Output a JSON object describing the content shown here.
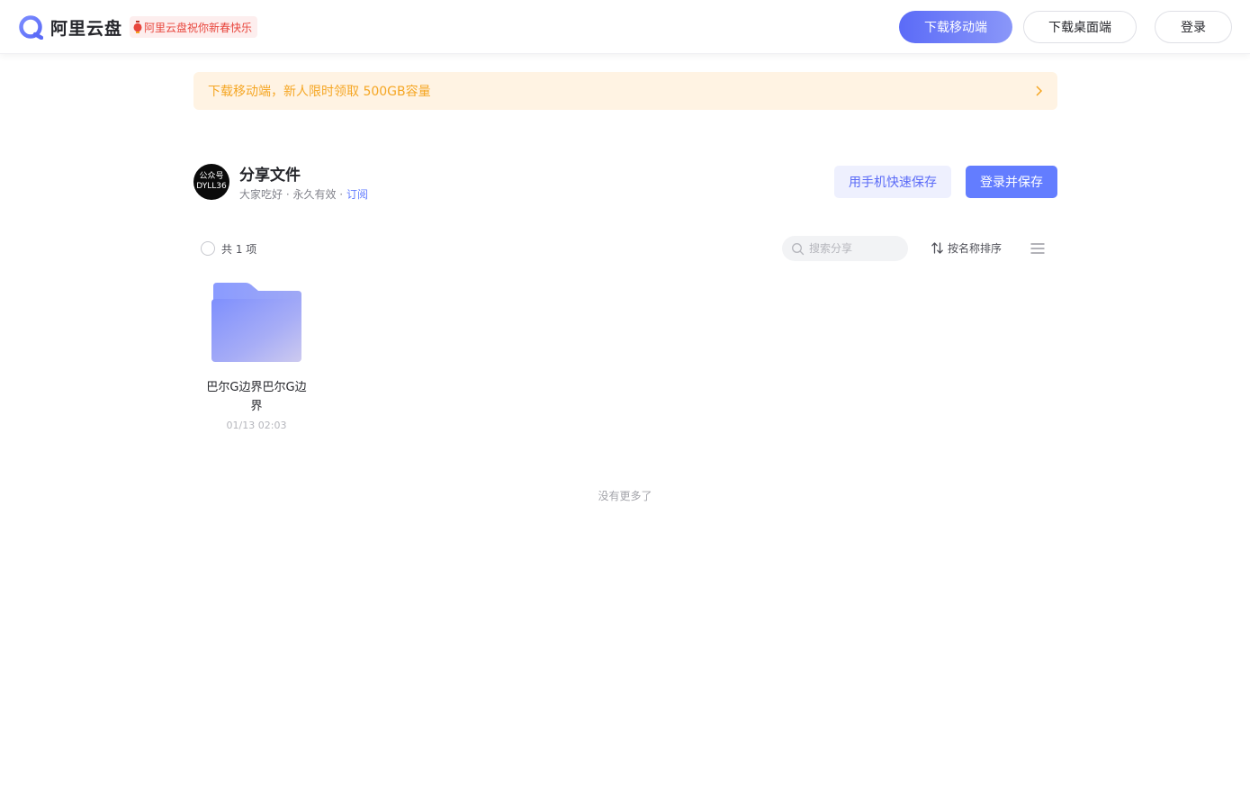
{
  "header": {
    "brand": "阿里云盘",
    "promo": "阿里云盘祝你新春快乐",
    "download_mobile": "下载移动端",
    "download_desktop": "下载桌面端",
    "login": "登录"
  },
  "banner": {
    "text": "下载移动端，新人限时领取 500GB容量"
  },
  "share": {
    "avatar_line1": "公众号",
    "avatar_line2": "DYLL36",
    "title": "分享文件",
    "greeting": "大家吃好",
    "sep1": " · ",
    "validity": "永久有效",
    "sep2": " · ",
    "subscribe": "订阅",
    "quick_save": "用手机快速保存",
    "login_save": "登录并保存"
  },
  "toolbar": {
    "count": "共 1 项",
    "search_placeholder": "搜索分享",
    "sort_label": "按名称排序"
  },
  "files": [
    {
      "name": "巴尔G边界巴尔G边界",
      "date": "01/13 02:03"
    }
  ],
  "footer": {
    "no_more": "没有更多了"
  },
  "colors": {
    "accent": "#637dff",
    "banner_bg": "#fff3e3",
    "banner_text": "#f5a623",
    "promo_text": "#e8453c"
  }
}
